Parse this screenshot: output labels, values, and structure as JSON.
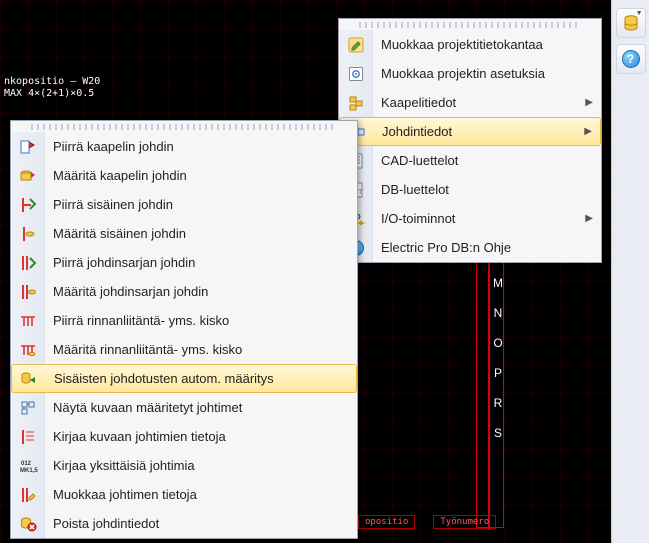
{
  "status": {
    "line1": "nkopositio — W20",
    "line2": "MAX 4×(2+1)×0.5"
  },
  "top_menu": {
    "items": [
      {
        "label": "Muokkaa projektitietokantaa",
        "submenu": false
      },
      {
        "label": "Muokkaa projektin asetuksia",
        "submenu": false
      },
      {
        "label": "Kaapelitiedot",
        "submenu": true
      },
      {
        "label": "Johdintiedot",
        "submenu": true,
        "highlight": true
      },
      {
        "label": "CAD-luettelot",
        "submenu": false
      },
      {
        "label": "DB-luettelot",
        "submenu": false
      },
      {
        "label": "I/O-toiminnot",
        "submenu": true
      },
      {
        "label": "Electric Pro DB:n Ohje",
        "submenu": false
      }
    ]
  },
  "left_menu": {
    "items": [
      {
        "label": "Piirrä kaapelin johdin"
      },
      {
        "label": "Määritä kaapelin johdin"
      },
      {
        "label": "Piirrä sisäinen johdin"
      },
      {
        "label": "Määritä sisäinen johdin"
      },
      {
        "label": "Piirrä johdinsarjan johdin"
      },
      {
        "label": "Määritä johdinsarjan johdin"
      },
      {
        "label": "Piirrä rinnanliitäntä- yms. kisko"
      },
      {
        "label": "Määritä rinnanliitäntä- yms. kisko"
      },
      {
        "label": "Sisäisten johdotusten autom. määritys",
        "highlight": true
      },
      {
        "label": "Näytä kuvaan määritetyt johtimet"
      },
      {
        "label": "Kirjaa kuvaan johtimien tietoja"
      },
      {
        "label": "Kirjaa yksittäisiä johtimia"
      },
      {
        "label": "Muokkaa johtimen tietoja"
      },
      {
        "label": "Poista johdintiedot"
      }
    ]
  },
  "cad_letters": [
    "M",
    "N",
    "O",
    "P",
    "R",
    "S"
  ],
  "bottom_labels": [
    "opositio",
    "Työnumero"
  ],
  "icons": {
    "db": "db-icon",
    "help": "help-icon"
  }
}
